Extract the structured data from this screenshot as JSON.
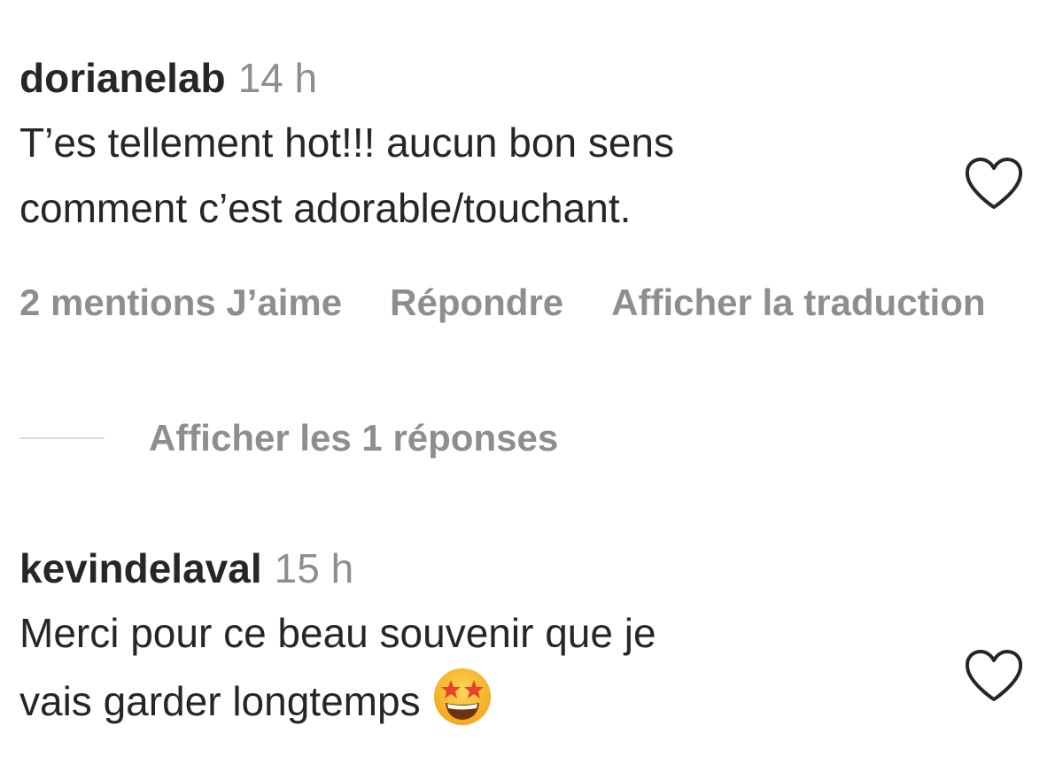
{
  "comments": [
    {
      "username": "dorianelab",
      "time": "14 h",
      "text_line1": "T’es tellement hot!!! aucun bon sens",
      "text_line2": "comment c’est adorable/touchant.",
      "likes": "2 mentions J’aime",
      "reply": "Répondre",
      "translate": "Afficher la traduction",
      "view_replies": "Afficher les 1 réponses"
    },
    {
      "username": "kevindelaval",
      "time": "15 h",
      "text_line1": "Merci pour ce beau souvenir que je",
      "text_line2": "vais garder longtemps"
    }
  ],
  "icons": {
    "like": "heart-outline-icon",
    "emoji": "star-struck-emoji"
  },
  "colors": {
    "primary_text": "#262626",
    "secondary_text": "#8e8e8e",
    "divider": "#dbdbdb"
  }
}
